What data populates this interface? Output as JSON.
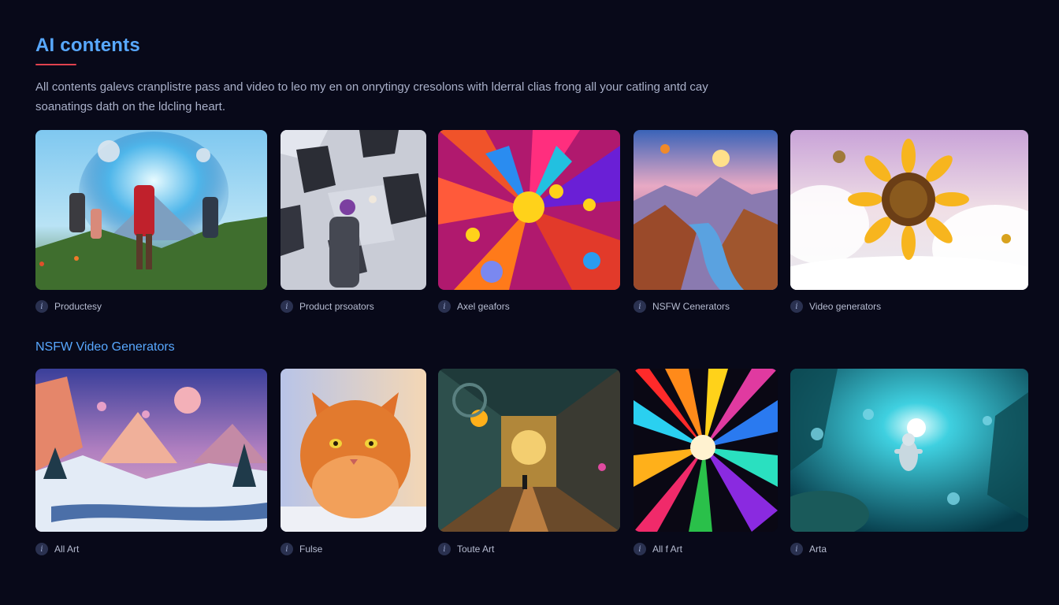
{
  "header": {
    "title": "AI contents",
    "description": "All contents galevs cranplistre pass and video to leo my en on onrytingy cresolons with lderral clias frong all your catling antd cay soanatings dath on the ldcling heart."
  },
  "section2": {
    "title": "NSFW Video Generators"
  },
  "row1": [
    {
      "label": "Productesy",
      "scene": "hikers-portal"
    },
    {
      "label": "Product prsoators",
      "scene": "soccer-dome"
    },
    {
      "label": "Axel geafors",
      "scene": "color-burst"
    },
    {
      "label": "NSFW Cenerators",
      "scene": "valley-sunset"
    },
    {
      "label": "Video generators",
      "scene": "sunflower-sky"
    }
  ],
  "row2": [
    {
      "label": "All Art",
      "scene": "winter-mountains"
    },
    {
      "label": "Fulse",
      "scene": "orange-cat"
    },
    {
      "label": "Toute Art",
      "scene": "neon-alley"
    },
    {
      "label": "All f Art",
      "scene": "rainbow-rays"
    },
    {
      "label": "Arta",
      "scene": "underwater-diver"
    }
  ],
  "icons": {
    "caption_icon": "info-icon"
  },
  "colors": {
    "accent": "#58a8ff",
    "underline": "#e0424e",
    "background": "#080919"
  }
}
